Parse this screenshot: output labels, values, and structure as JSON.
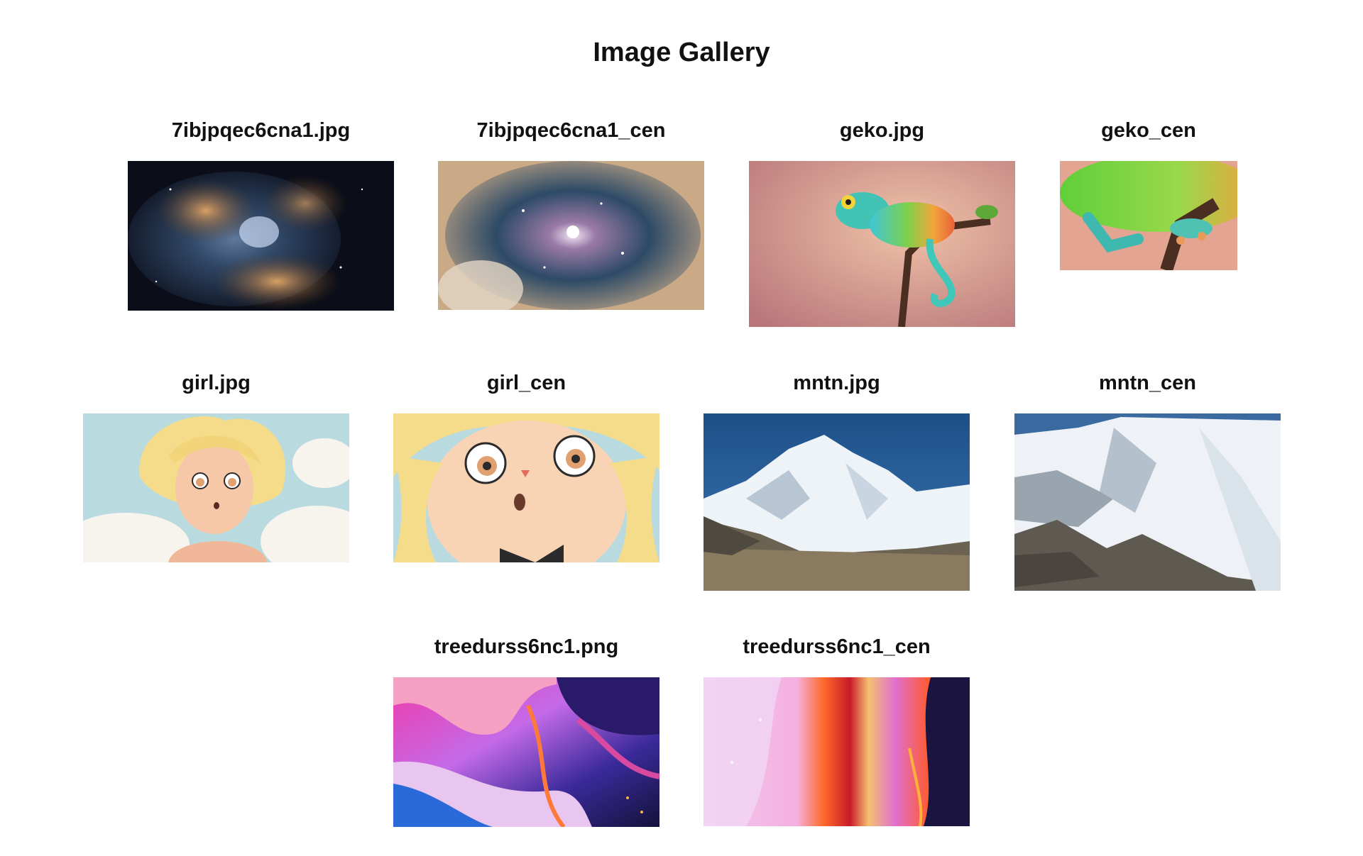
{
  "gallery": {
    "title": "Image Gallery",
    "items": [
      {
        "caption": "7ibjpqec6cna1.jpg",
        "image": "nebula"
      },
      {
        "caption": "7ibjpqec6cna1_cen",
        "image": "nebula-center"
      },
      {
        "caption": "geko.jpg",
        "image": "chameleon"
      },
      {
        "caption": "geko_cen",
        "image": "chameleon-center"
      },
      {
        "caption": "girl.jpg",
        "image": "anime-girl"
      },
      {
        "caption": "girl_cen",
        "image": "anime-girl-center"
      },
      {
        "caption": "mntn.jpg",
        "image": "mountain"
      },
      {
        "caption": "mntn_cen",
        "image": "mountain-center"
      },
      {
        "caption": "treedurss6nc1.png",
        "image": "fluid-abstract"
      },
      {
        "caption": "treedurss6nc1_cen",
        "image": "fluid-abstract-center"
      }
    ]
  }
}
